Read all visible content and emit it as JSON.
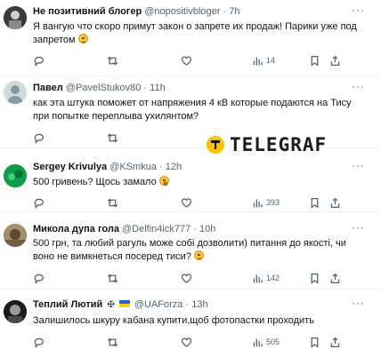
{
  "tweets": [
    {
      "name": "Не позитивний блогер",
      "handle": "@nopositivbloger",
      "time": "7h",
      "text": "Я вангую что скоро примут закон о запрете их продаж! Парики уже под запретом",
      "emoji": "grin",
      "views": "14",
      "replies": "",
      "retweets": "",
      "likes": ""
    },
    {
      "name": "Павел",
      "handle": "@PavelStukov80",
      "time": "11h",
      "text": "как эта штука поможет от напряжения 4 кВ которые подаются на Тису при попытке переплыва ухилянтом?",
      "views": ""
    },
    {
      "name": "Sergey Krivulya",
      "handle": "@KSmkua",
      "time": "12h",
      "text": "500 гривень? Щось замало",
      "emoji": "shocked",
      "views": "393"
    },
    {
      "name": "Микола дупа гола",
      "handle": "@Delfin4ick777",
      "time": "10h",
      "text": "500 грн, та любий рагуль може собі дозволити) питання до якості, чи воно не вимкнеться посеред тиси?",
      "emoji": "grin",
      "views": "142"
    },
    {
      "name": "Теплий Лютий",
      "handle": "@UAForza",
      "time": "13h",
      "text": "Залишилось шкуру кабана купити,щоб фотопастки проходить",
      "views": "505"
    }
  ],
  "watermark": {
    "text": "TELEGRAF",
    "color": "#f6c500"
  },
  "dot": "·",
  "more": "···",
  "icons": [
    "reply-icon",
    "retweet-icon",
    "like-icon",
    "views-icon",
    "bookmark-icon",
    "share-icon"
  ]
}
